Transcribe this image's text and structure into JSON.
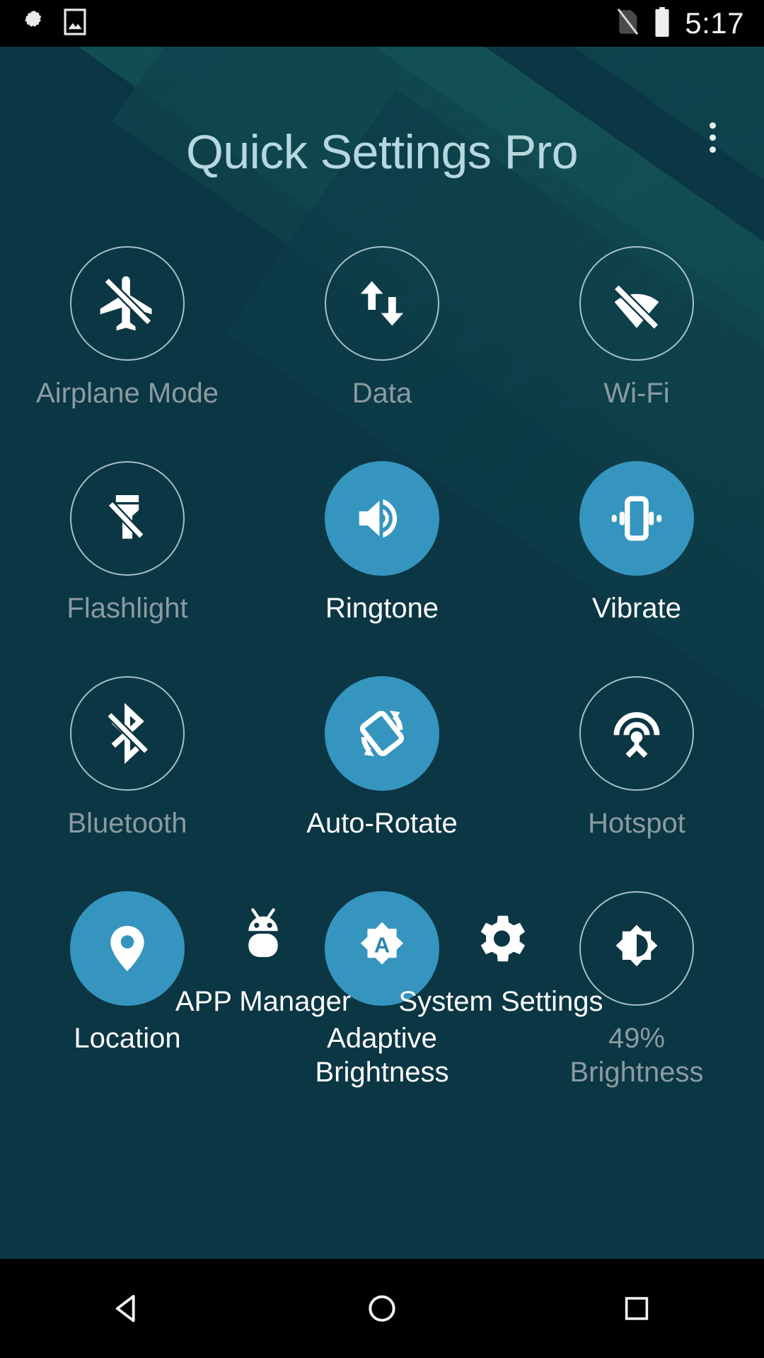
{
  "status_bar": {
    "time": "5:17",
    "icons": [
      "settings-gear-icon",
      "image-icon",
      "no-sim-icon",
      "battery-full-icon"
    ]
  },
  "header": {
    "title": "Quick Settings Pro",
    "overflow_menu": "overflow-menu-icon",
    "title_color": "#b5d8de"
  },
  "theme": {
    "background": "#0b3644",
    "accent_on": "#3695bf",
    "label_off": "#8a9ba0",
    "label_on": "#ffffff"
  },
  "tiles": [
    {
      "id": "airplane-mode",
      "label": "Airplane Mode",
      "icon": "airplane-off-icon",
      "state": "off"
    },
    {
      "id": "data",
      "label": "Data",
      "icon": "data-sync-icon",
      "state": "off"
    },
    {
      "id": "wifi",
      "label": "Wi-Fi",
      "icon": "wifi-off-icon",
      "state": "off"
    },
    {
      "id": "flashlight",
      "label": "Flashlight",
      "icon": "flashlight-off-icon",
      "state": "off"
    },
    {
      "id": "ringtone",
      "label": "Ringtone",
      "icon": "volume-up-icon",
      "state": "on"
    },
    {
      "id": "vibrate",
      "label": "Vibrate",
      "icon": "vibration-icon",
      "state": "on"
    },
    {
      "id": "bluetooth",
      "label": "Bluetooth",
      "icon": "bluetooth-off-icon",
      "state": "off"
    },
    {
      "id": "auto-rotate",
      "label": "Auto-Rotate",
      "icon": "screen-rotation-icon",
      "state": "on"
    },
    {
      "id": "hotspot",
      "label": "Hotspot",
      "icon": "hotspot-icon",
      "state": "off"
    },
    {
      "id": "location",
      "label": "Location",
      "icon": "location-pin-icon",
      "state": "on"
    },
    {
      "id": "adaptive-brightness",
      "label": "Adaptive\nBrightness",
      "icon": "brightness-auto-icon",
      "state": "on"
    },
    {
      "id": "brightness",
      "label": "49%\nBrightness",
      "icon": "brightness-medium-icon",
      "state": "off",
      "value": "49%"
    }
  ],
  "bottom_actions": [
    {
      "id": "app-manager",
      "label": "APP Manager",
      "icon": "android-robot-icon"
    },
    {
      "id": "system-settings",
      "label": "System Settings",
      "icon": "gear-icon"
    }
  ],
  "nav_bar": {
    "back": "back-triangle-icon",
    "home": "home-circle-icon",
    "recents": "recents-square-icon"
  }
}
